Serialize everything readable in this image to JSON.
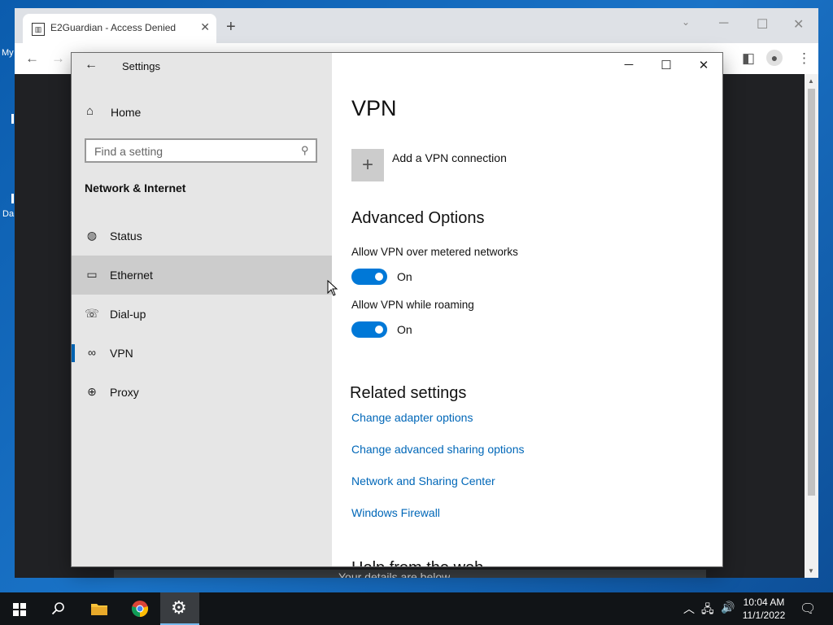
{
  "desktop": {
    "fragments": [
      "My",
      "Da"
    ]
  },
  "browser": {
    "tab_title": "E2Guardian - Access Denied",
    "page_footer_partial": "Your details are below"
  },
  "settings": {
    "window_title": "Settings",
    "home_label": "Home",
    "search_placeholder": "Find a setting",
    "section_header": "Network & Internet",
    "nav": [
      {
        "label": "Status",
        "icon": "globe-status-icon"
      },
      {
        "label": "Ethernet",
        "icon": "ethernet-icon"
      },
      {
        "label": "Dial-up",
        "icon": "dialup-icon"
      },
      {
        "label": "VPN",
        "icon": "vpn-icon"
      },
      {
        "label": "Proxy",
        "icon": "globe-icon"
      }
    ],
    "hovered_item": "Ethernet",
    "selected_item": "VPN",
    "main": {
      "title": "VPN",
      "add_vpn": "Add a VPN connection",
      "advanced_heading": "Advanced Options",
      "options": [
        {
          "label": "Allow VPN over metered networks",
          "state": "On",
          "on": true
        },
        {
          "label": "Allow VPN while roaming",
          "state": "On",
          "on": true
        }
      ],
      "related_heading": "Related settings",
      "links": [
        "Change adapter options",
        "Change advanced sharing options",
        "Network and Sharing Center",
        "Windows Firewall"
      ],
      "next_heading_partial": "Help from the web"
    },
    "accent_color": "#0078d7",
    "link_color": "#0067b8"
  },
  "taskbar": {
    "time": "10:04 AM",
    "date": "11/1/2022"
  }
}
